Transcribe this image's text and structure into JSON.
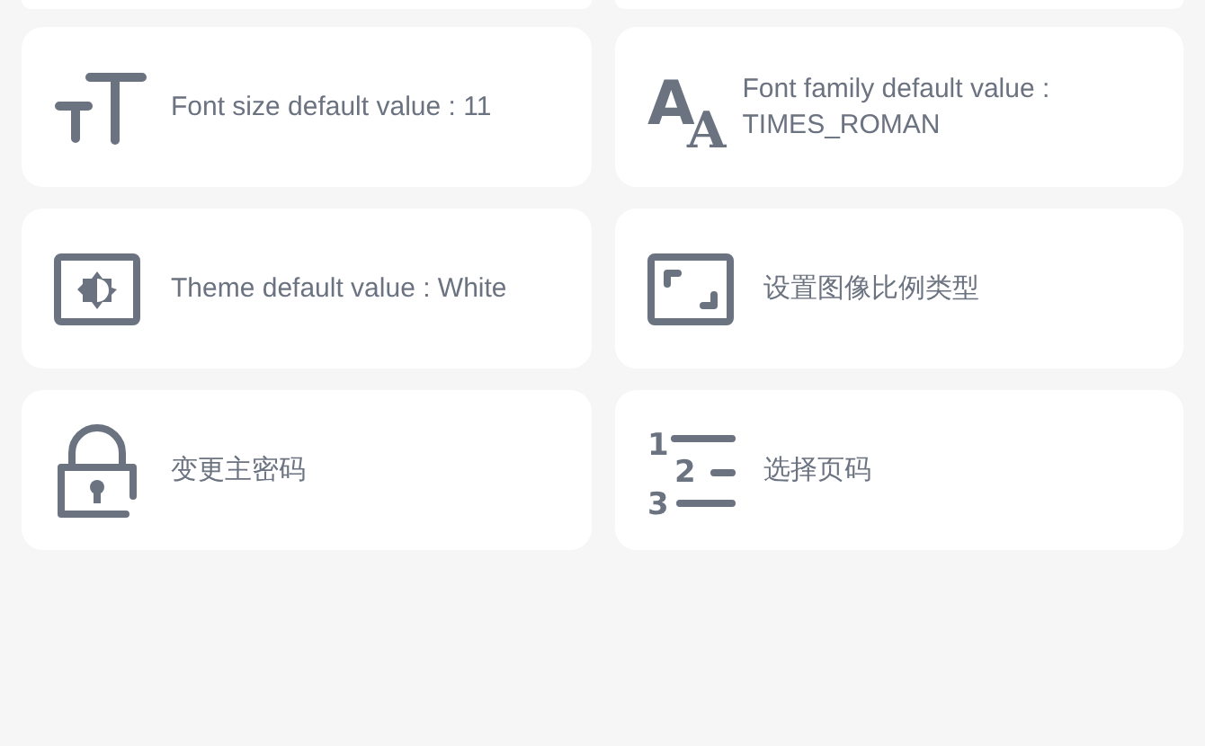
{
  "settings": [
    {
      "kind": "font_size",
      "label": "Font size default value : 11"
    },
    {
      "kind": "font_family",
      "label": "Font family default value : TIMES_ROMAN",
      "icon_text": [
        "A",
        "A"
      ]
    },
    {
      "kind": "theme",
      "label": "Theme default value : White"
    },
    {
      "kind": "aspect_ratio",
      "label": "设置图像比例类型"
    },
    {
      "kind": "password",
      "label": "变更主密码"
    },
    {
      "kind": "page_number",
      "label": "选择页码",
      "icon_text": [
        "1",
        "2",
        "3"
      ]
    }
  ]
}
